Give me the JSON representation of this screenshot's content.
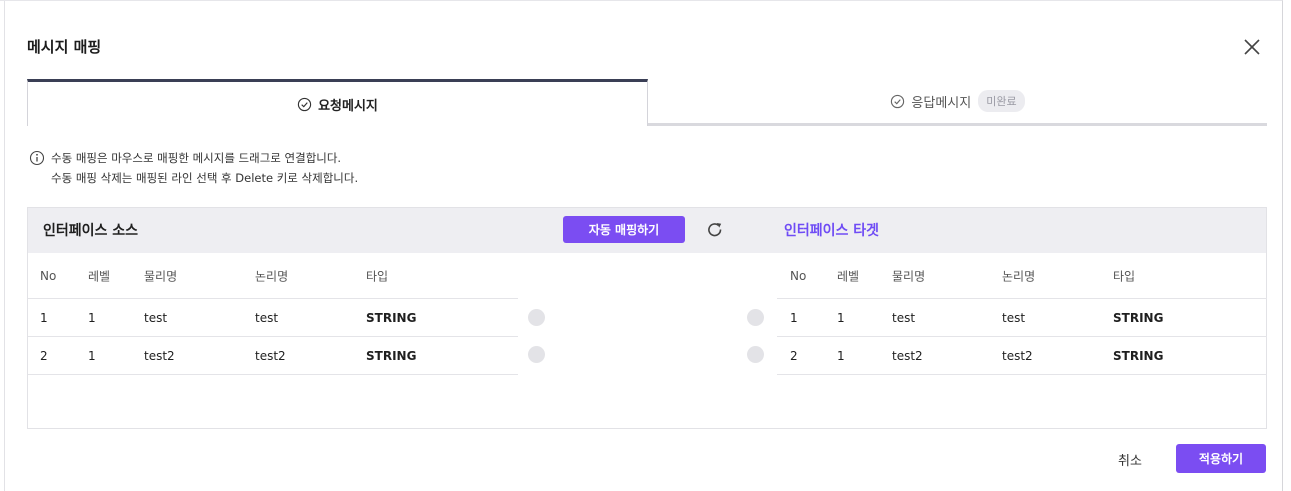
{
  "dialog": {
    "title": "메시지 매핑",
    "close_icon": "close-icon"
  },
  "tabs": [
    {
      "label": "요청메시지",
      "icon": "check-circle-icon",
      "active": true
    },
    {
      "label": "응답메시지",
      "icon": "check-circle-icon",
      "active": false,
      "badge": "미완료"
    }
  ],
  "info": {
    "icon": "info-circle-icon",
    "line1": "수동 매핑은 마우스로 매핑한 메시지를 드래그로 연결합니다.",
    "line2": "수동 매핑 삭제는 매핑된 라인 선택 후 Delete 키로 삭제합니다."
  },
  "mapping": {
    "source_title": "인터페이스 소스",
    "target_title": "인터페이스 타겟",
    "auto_map_label": "자동 매핑하기",
    "refresh_icon": "refresh-icon",
    "columns": [
      "No",
      "레벨",
      "물리명",
      "논리명",
      "타입"
    ],
    "source_rows": [
      {
        "no": "1",
        "level": "1",
        "physical": "test",
        "logical": "test",
        "type": "STRING"
      },
      {
        "no": "2",
        "level": "1",
        "physical": "test2",
        "logical": "test2",
        "type": "STRING"
      }
    ],
    "target_rows": [
      {
        "no": "1",
        "level": "1",
        "physical": "test",
        "logical": "test",
        "type": "STRING"
      },
      {
        "no": "2",
        "level": "1",
        "physical": "test2",
        "logical": "test2",
        "type": "STRING"
      }
    ]
  },
  "footer": {
    "cancel_label": "취소",
    "apply_label": "적용하기"
  },
  "colors": {
    "accent": "#7b4df2",
    "target_title": "#6f4cf5",
    "active_tab_border": "#3a3f55",
    "header_bg": "#eeeef2"
  }
}
